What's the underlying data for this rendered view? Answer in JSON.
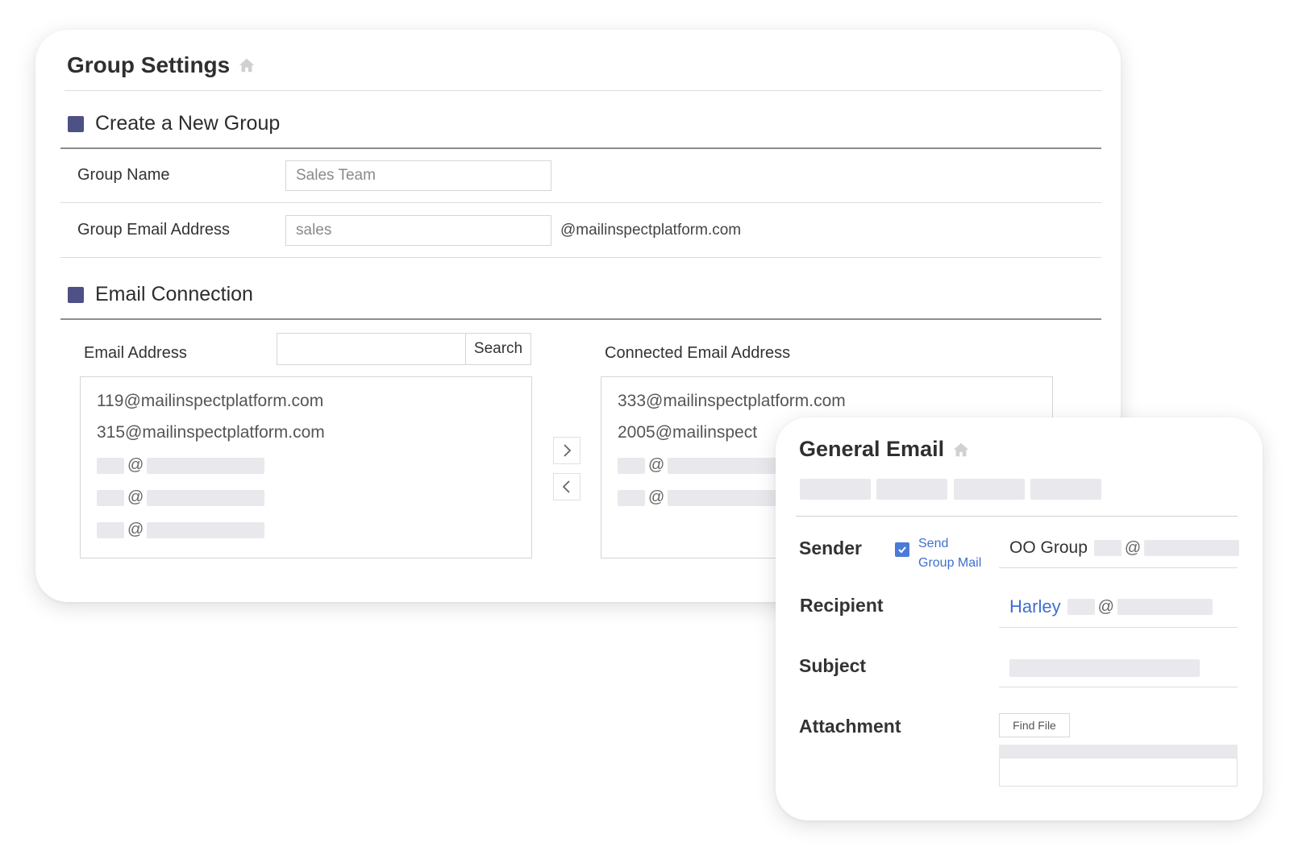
{
  "group_settings": {
    "title": "Group Settings",
    "create_section": {
      "heading": "Create a New Group",
      "group_name_label": "Group Name",
      "group_name_value": "Sales Team",
      "group_email_label": "Group Email Address",
      "group_email_value": "sales",
      "domain_suffix": "@mailinspectplatform.com"
    },
    "connection_section": {
      "heading": "Email Connection",
      "email_address_label": "Email Address",
      "search_button": "Search",
      "connected_label": "Connected Email Address",
      "available_emails": [
        "119@mailinspectplatform.com",
        "315@mailinspectplatform.com"
      ],
      "connected_emails": [
        "333@mailinspectplatform.com",
        "2005@mailinspect"
      ],
      "at_symbol": "@"
    }
  },
  "general_email": {
    "title": "General Email",
    "sender_label": "Sender",
    "send_group_mail_line1": "Send",
    "send_group_mail_line2": "Group Mail",
    "send_group_mail_checked": true,
    "sender_value": "OO Group",
    "recipient_label": "Recipient",
    "recipient_name": "Harley",
    "subject_label": "Subject",
    "attachment_label": "Attachment",
    "find_file_button": "Find File",
    "at_symbol": "@"
  },
  "colors": {
    "section_square": "#4e5186",
    "link_blue": "#3f6fd0",
    "placeholder_gray": "#e9e9ed"
  },
  "icons": [
    "home-icon",
    "chevron-right-icon",
    "chevron-left-icon",
    "checkmark-icon"
  ]
}
